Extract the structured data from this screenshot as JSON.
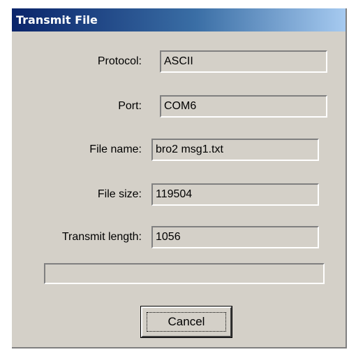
{
  "window": {
    "title": "Transmit File"
  },
  "fields": [
    {
      "label": "Protocol:",
      "value": "ASCII"
    },
    {
      "label": "Port:",
      "value": "COM6"
    },
    {
      "label": "File name:",
      "value": "bro2 msg1.txt"
    },
    {
      "label": "File size:",
      "value": "119504"
    },
    {
      "label": "Transmit length:",
      "value": "1056"
    }
  ],
  "progress": {
    "fraction": 0
  },
  "buttons": {
    "cancel_label": "Cancel"
  },
  "colors": {
    "dialog_bg": "#d4d0c8",
    "title_gradient_start": "#0a246a",
    "title_gradient_end": "#a6caf0",
    "title_text": "#ffffff"
  }
}
